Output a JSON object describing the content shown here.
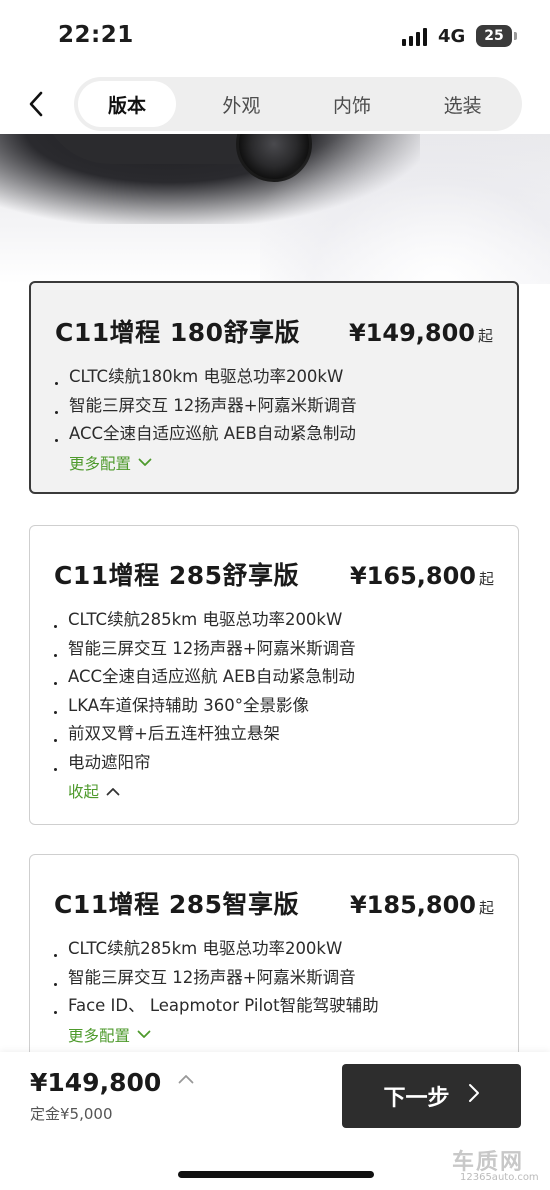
{
  "status": {
    "time": "22:21",
    "network": "4G",
    "battery": "25"
  },
  "nav": {
    "tabs": [
      {
        "label": "版本",
        "active": true
      },
      {
        "label": "外观",
        "active": false
      },
      {
        "label": "内饰",
        "active": false
      },
      {
        "label": "选装",
        "active": false
      }
    ]
  },
  "versions": [
    {
      "title": "C11增程 180舒享版",
      "price": "¥149,800",
      "price_suffix": "起",
      "selected": true,
      "features": [
        "CLTC续航180km 电驱总功率200kW",
        "智能三屏交互 12扬声器+阿嘉米斯调音",
        "ACC全速自适应巡航 AEB自动紧急制动"
      ],
      "toggle": "更多配置"
    },
    {
      "title": "C11增程 285舒享版",
      "price": "¥165,800",
      "price_suffix": "起",
      "selected": false,
      "features": [
        "CLTC续航285km 电驱总功率200kW",
        "智能三屏交互 12扬声器+阿嘉米斯调音",
        "ACC全速自适应巡航 AEB自动紧急制动",
        "LKA车道保持辅助 360°全景影像",
        "前双叉臂+后五连杆独立悬架",
        "电动遮阳帘"
      ],
      "toggle": "收起"
    },
    {
      "title": "C11增程 285智享版",
      "price": "¥185,800",
      "price_suffix": "起",
      "selected": false,
      "features": [
        "CLTC续航285km 电驱总功率200kW",
        "智能三屏交互 12扬声器+阿嘉米斯调音",
        "Face ID、 Leapmotor Pilot智能驾驶辅助"
      ],
      "toggle": "更多配置"
    }
  ],
  "bottom": {
    "total_price": "¥149,800",
    "deposit": "定金¥5,000",
    "next_label": "下一步"
  },
  "watermark": {
    "text": "车质网",
    "url": "12365auto.com"
  },
  "colors": {
    "accent_green": "#4e9a2c",
    "button_dark": "#2d2d2d"
  }
}
